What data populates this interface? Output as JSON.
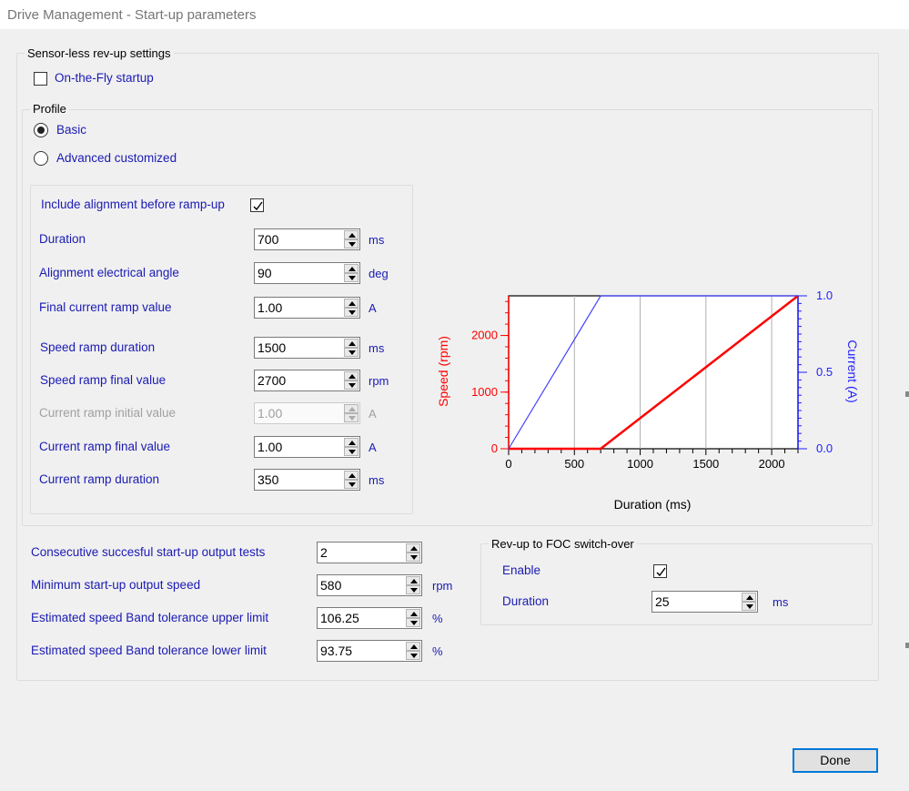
{
  "window": {
    "title": "Drive Management - Start-up parameters"
  },
  "sensorless": {
    "title": "Sensor-less rev-up settings",
    "on_the_fly": {
      "label": "On-the-Fly startup",
      "checked": false
    }
  },
  "profile": {
    "title": "Profile",
    "options": [
      {
        "label": "Basic",
        "selected": true
      },
      {
        "label": "Advanced customized",
        "selected": false
      }
    ]
  },
  "alignment": {
    "include_label": "Include alignment before ramp-up",
    "include_checked": true,
    "fields": [
      {
        "label": "Duration",
        "value": "700",
        "unit": "ms",
        "enabled": true
      },
      {
        "label": "Alignment electrical angle",
        "value": "90",
        "unit": "deg",
        "enabled": true
      },
      {
        "label": "Final current ramp value",
        "value": "1.00",
        "unit": "A",
        "enabled": true
      },
      {
        "label": "Speed ramp duration",
        "value": "1500",
        "unit": "ms",
        "enabled": true
      },
      {
        "label": "Speed ramp final value",
        "value": "2700",
        "unit": "rpm",
        "enabled": true
      },
      {
        "label": "Current ramp initial value",
        "value": "1.00",
        "unit": "A",
        "enabled": false
      },
      {
        "label": "Current ramp final value",
        "value": "1.00",
        "unit": "A",
        "enabled": true
      },
      {
        "label": "Current ramp duration",
        "value": "350",
        "unit": "ms",
        "enabled": true
      }
    ]
  },
  "output_tests": {
    "fields": [
      {
        "label": "Consecutive succesful start-up output tests",
        "value": "2",
        "unit": ""
      },
      {
        "label": "Minimum start-up output speed",
        "value": "580",
        "unit": "rpm"
      },
      {
        "label": "Estimated speed Band tolerance upper limit",
        "value": "106.25",
        "unit": "%"
      },
      {
        "label": "Estimated speed Band tolerance lower limit",
        "value": "93.75",
        "unit": "%"
      }
    ]
  },
  "foc_switch": {
    "title": "Rev-up to FOC switch-over",
    "enable_label": "Enable",
    "enable_checked": true,
    "duration_label": "Duration",
    "duration_value": "25",
    "duration_unit": "ms"
  },
  "buttons": {
    "done": "Done"
  },
  "chart_data": {
    "type": "line",
    "xlabel": "Duration (ms)",
    "ylabel": "Speed (rpm)",
    "y2label": "Current (A)",
    "xlim": [
      0,
      2200
    ],
    "ylim": [
      0,
      2700
    ],
    "y2lim": [
      0,
      1.0
    ],
    "x_ticks": [
      "0",
      "500",
      "1000",
      "1500",
      "2000"
    ],
    "x_tick_values": [
      0,
      500,
      1000,
      1500,
      2000
    ],
    "y_ticks": [
      "0",
      "1000",
      "2000"
    ],
    "y_tick_values": [
      0,
      1000,
      2000
    ],
    "y2_ticks": [
      "0.0",
      "0.5",
      "1.0"
    ],
    "y2_tick_values": [
      0,
      0.5,
      1.0
    ],
    "grid": true,
    "series": [
      {
        "axis": "left",
        "color": "#ff0000",
        "x": [
          0,
          700,
          2200
        ],
        "y": [
          0,
          0,
          2700
        ]
      },
      {
        "axis": "right",
        "color": "#4040ff",
        "x": [
          0,
          700,
          2200
        ],
        "y": [
          0,
          1.0,
          1.0
        ]
      }
    ]
  }
}
